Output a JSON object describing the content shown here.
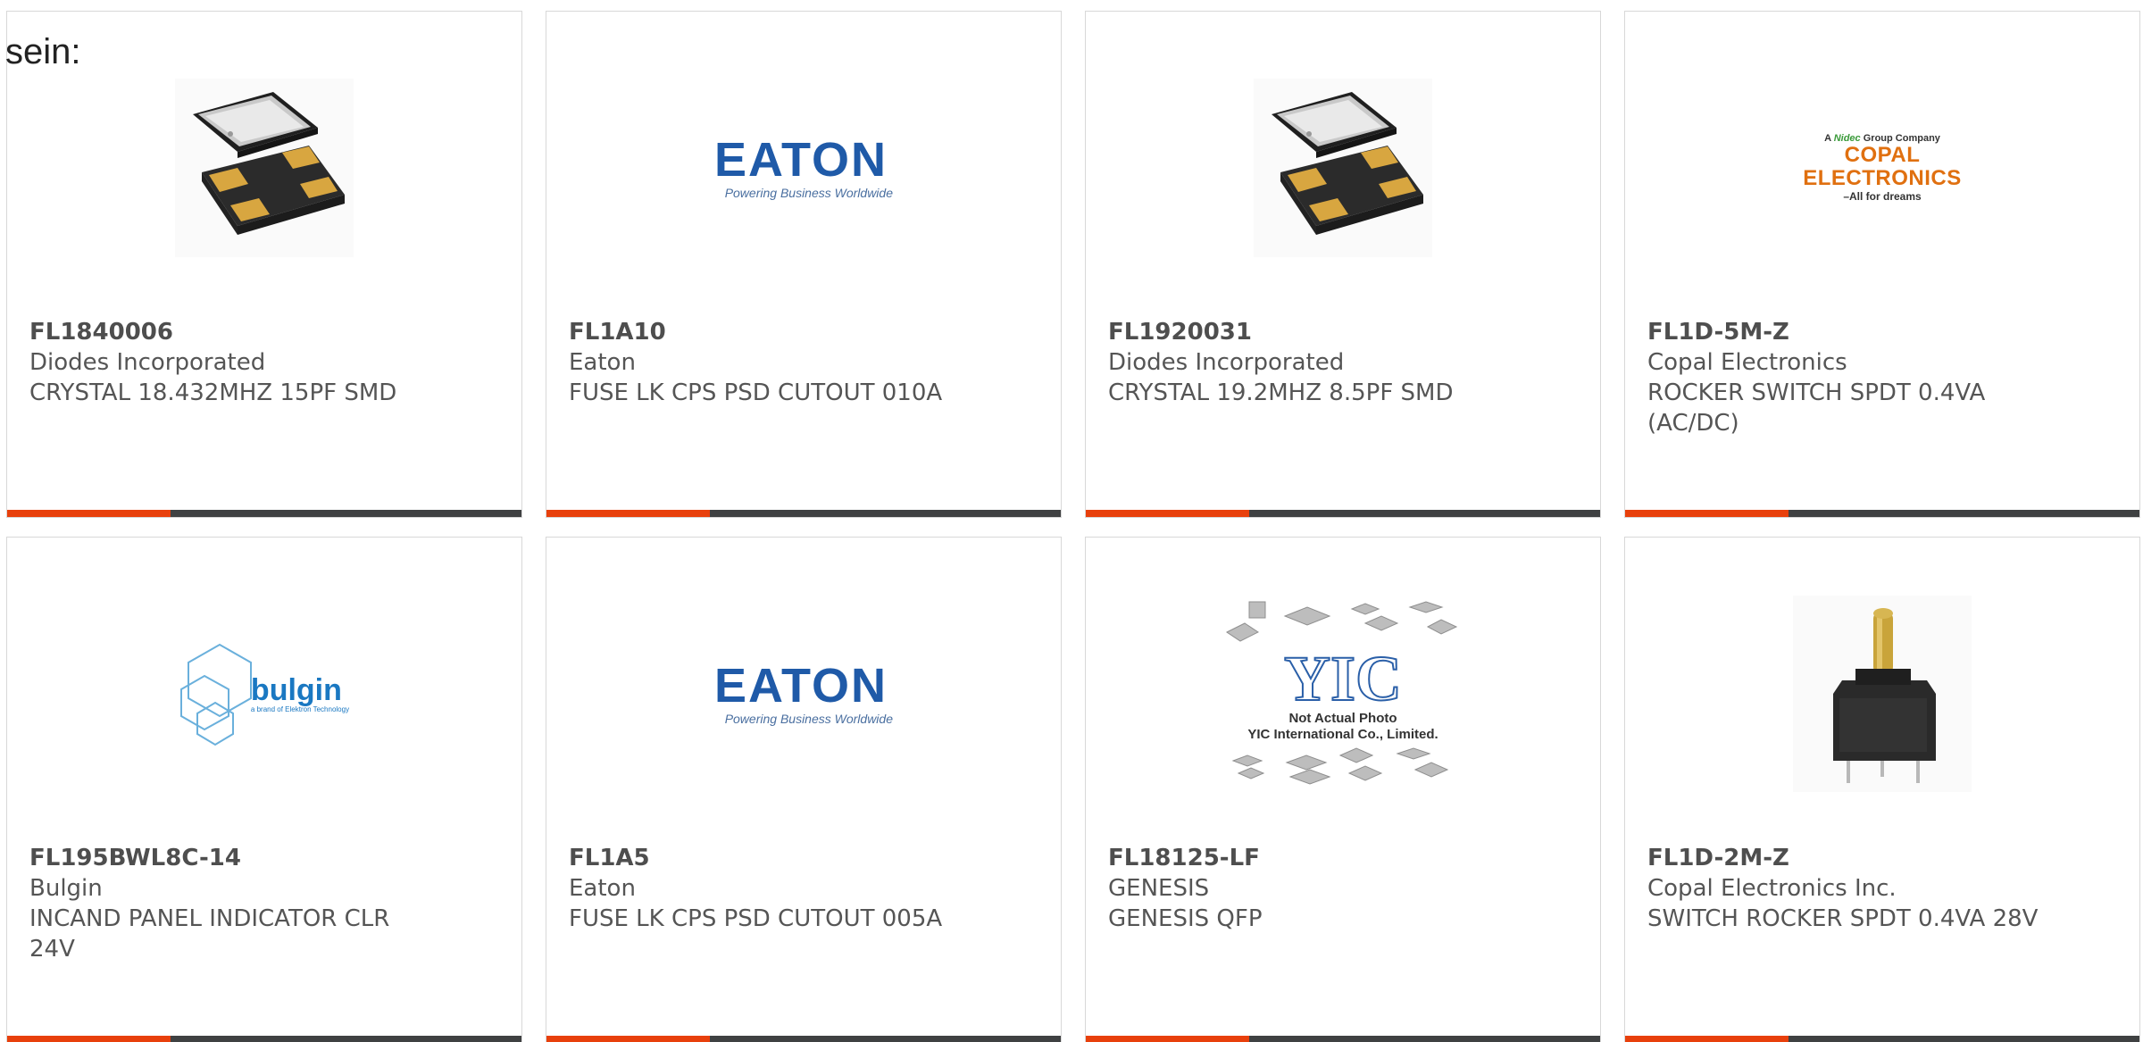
{
  "intro_text": "sein:",
  "colors": {
    "accent": "#e8400c",
    "bar": "#3f4142",
    "border": "#d8d8d8",
    "text": "#555555"
  },
  "cards": [
    {
      "part_number": "FL1840006",
      "manufacturer": "Diodes Incorporated",
      "description": "CRYSTAL 18.432MHZ 15PF SMD",
      "image": "crystal-photo"
    },
    {
      "part_number": "FL1A10",
      "manufacturer": "Eaton",
      "description": "FUSE LK CPS PSD CUTOUT 010A",
      "image": "eaton-logo",
      "logo_word": "EATON",
      "logo_tagline": "Powering Business Worldwide"
    },
    {
      "part_number": "FL1920031",
      "manufacturer": "Diodes Incorporated",
      "description": "CRYSTAL 19.2MHZ 8.5PF SMD",
      "image": "crystal-photo"
    },
    {
      "part_number": "FL1D-5M-Z",
      "manufacturer": "Copal Electronics",
      "description": "ROCKER SWITCH SPDT 0.4VA (AC/DC)",
      "image": "copal-logo",
      "logo_top_a": "A",
      "logo_top_nidec": "Nidec",
      "logo_top_b": "Group Company",
      "logo_main": "COPAL ELECTRONICS",
      "logo_tagline": "–All for dreams"
    },
    {
      "part_number": "FL195BWL8C-14",
      "manufacturer": "Bulgin",
      "description": "INCAND PANEL INDICATOR CLR 24V",
      "image": "bulgin-logo",
      "logo_word": "bulgin",
      "logo_tagline": "a brand of Elektron Technology"
    },
    {
      "part_number": "FL1A5",
      "manufacturer": "Eaton",
      "description": "FUSE LK CPS PSD CUTOUT 005A",
      "image": "eaton-logo",
      "logo_word": "EATON",
      "logo_tagline": "Powering Business Worldwide"
    },
    {
      "part_number": "FL18125-LF",
      "manufacturer": "GENESIS",
      "description": "GENESIS QFP",
      "image": "yic-placeholder",
      "logo_note_1": "Not Actual Photo",
      "logo_note_2": "YIC International Co., Limited."
    },
    {
      "part_number": "FL1D-2M-Z",
      "manufacturer": "Copal Electronics Inc.",
      "description": "SWITCH ROCKER SPDT 0.4VA 28V",
      "image": "rocker-switch-photo"
    }
  ]
}
